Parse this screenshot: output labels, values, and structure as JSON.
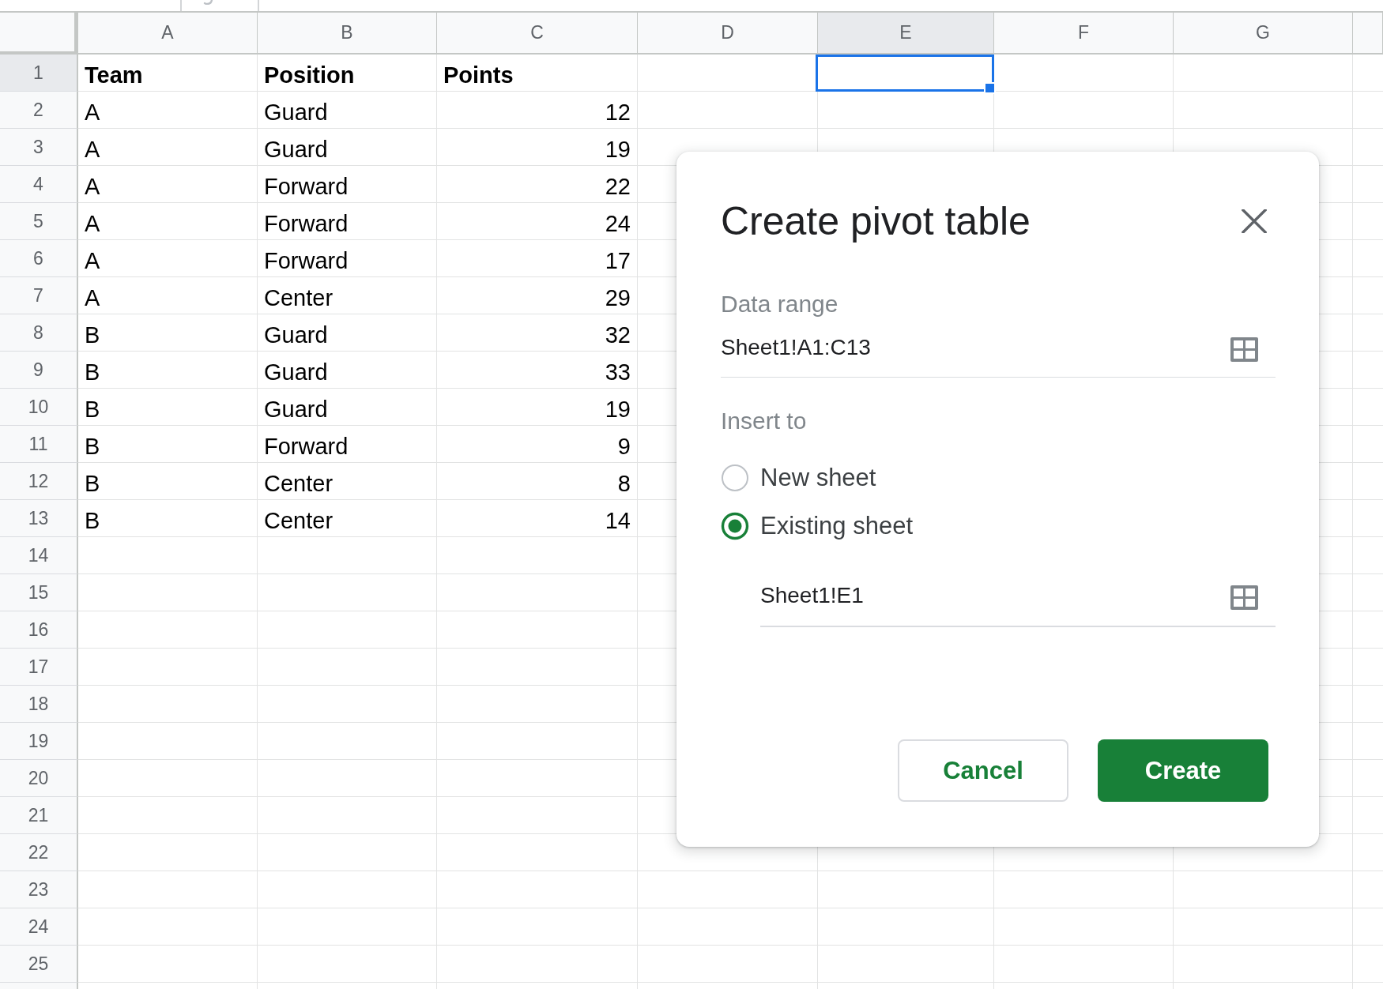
{
  "sheet": {
    "columns": [
      {
        "label": "A",
        "selected": false
      },
      {
        "label": "B",
        "selected": false
      },
      {
        "label": "C",
        "selected": false
      },
      {
        "label": "D",
        "selected": false
      },
      {
        "label": "E",
        "selected": true
      },
      {
        "label": "F",
        "selected": false
      },
      {
        "label": "G",
        "selected": false
      }
    ],
    "rows": [
      {
        "number": "1",
        "selected": true,
        "kind": "header",
        "cells": [
          {
            "text": "Team",
            "kind": "text"
          },
          {
            "text": "Position",
            "kind": "text"
          },
          {
            "text": "Points",
            "kind": "text"
          }
        ]
      },
      {
        "number": "2",
        "selected": false,
        "kind": "data",
        "cells": [
          {
            "text": "A",
            "kind": "text"
          },
          {
            "text": "Guard",
            "kind": "text"
          },
          {
            "text": "12",
            "kind": "number"
          }
        ]
      },
      {
        "number": "3",
        "selected": false,
        "kind": "data",
        "cells": [
          {
            "text": "A",
            "kind": "text"
          },
          {
            "text": "Guard",
            "kind": "text"
          },
          {
            "text": "19",
            "kind": "number"
          }
        ]
      },
      {
        "number": "4",
        "selected": false,
        "kind": "data",
        "cells": [
          {
            "text": "A",
            "kind": "text"
          },
          {
            "text": "Forward",
            "kind": "text"
          },
          {
            "text": "22",
            "kind": "number"
          }
        ]
      },
      {
        "number": "5",
        "selected": false,
        "kind": "data",
        "cells": [
          {
            "text": "A",
            "kind": "text"
          },
          {
            "text": "Forward",
            "kind": "text"
          },
          {
            "text": "24",
            "kind": "number"
          }
        ]
      },
      {
        "number": "6",
        "selected": false,
        "kind": "data",
        "cells": [
          {
            "text": "A",
            "kind": "text"
          },
          {
            "text": "Forward",
            "kind": "text"
          },
          {
            "text": "17",
            "kind": "number"
          }
        ]
      },
      {
        "number": "7",
        "selected": false,
        "kind": "data",
        "cells": [
          {
            "text": "A",
            "kind": "text"
          },
          {
            "text": "Center",
            "kind": "text"
          },
          {
            "text": "29",
            "kind": "number"
          }
        ]
      },
      {
        "number": "8",
        "selected": false,
        "kind": "data",
        "cells": [
          {
            "text": "B",
            "kind": "text"
          },
          {
            "text": "Guard",
            "kind": "text"
          },
          {
            "text": "32",
            "kind": "number"
          }
        ]
      },
      {
        "number": "9",
        "selected": false,
        "kind": "data",
        "cells": [
          {
            "text": "B",
            "kind": "text"
          },
          {
            "text": "Guard",
            "kind": "text"
          },
          {
            "text": "33",
            "kind": "number"
          }
        ]
      },
      {
        "number": "10",
        "selected": false,
        "kind": "data",
        "cells": [
          {
            "text": "B",
            "kind": "text"
          },
          {
            "text": "Guard",
            "kind": "text"
          },
          {
            "text": "19",
            "kind": "number"
          }
        ]
      },
      {
        "number": "11",
        "selected": false,
        "kind": "data",
        "cells": [
          {
            "text": "B",
            "kind": "text"
          },
          {
            "text": "Forward",
            "kind": "text"
          },
          {
            "text": "9",
            "kind": "number"
          }
        ]
      },
      {
        "number": "12",
        "selected": false,
        "kind": "data",
        "cells": [
          {
            "text": "B",
            "kind": "text"
          },
          {
            "text": "Center",
            "kind": "text"
          },
          {
            "text": "8",
            "kind": "number"
          }
        ]
      },
      {
        "number": "13",
        "selected": false,
        "kind": "data",
        "cells": [
          {
            "text": "B",
            "kind": "text"
          },
          {
            "text": "Center",
            "kind": "text"
          },
          {
            "text": "14",
            "kind": "number"
          }
        ]
      },
      {
        "number": "14",
        "selected": false,
        "kind": "data"
      },
      {
        "number": "15",
        "selected": false,
        "kind": "data"
      },
      {
        "number": "16",
        "selected": false,
        "kind": "data"
      },
      {
        "number": "17",
        "selected": false,
        "kind": "data"
      },
      {
        "number": "18",
        "selected": false,
        "kind": "data"
      },
      {
        "number": "19",
        "selected": false,
        "kind": "data"
      },
      {
        "number": "20",
        "selected": false,
        "kind": "data"
      },
      {
        "number": "21",
        "selected": false,
        "kind": "data"
      },
      {
        "number": "22",
        "selected": false,
        "kind": "data"
      },
      {
        "number": "23",
        "selected": false,
        "kind": "data"
      },
      {
        "number": "24",
        "selected": false,
        "kind": "data"
      },
      {
        "number": "25",
        "selected": false,
        "kind": "data"
      }
    ]
  },
  "dialog": {
    "title": "Create pivot table",
    "data_range": {
      "label": "Data range",
      "value": "Sheet1!A1:C13"
    },
    "insert_to": {
      "label": "Insert to",
      "options": [
        {
          "label": "New sheet",
          "selected": false
        },
        {
          "label": "Existing sheet",
          "selected": true
        }
      ],
      "location": {
        "value": "Sheet1!E1"
      }
    },
    "buttons": [
      {
        "label": "Cancel",
        "kind": "secondary"
      },
      {
        "label": "Create",
        "kind": "primary"
      }
    ]
  }
}
